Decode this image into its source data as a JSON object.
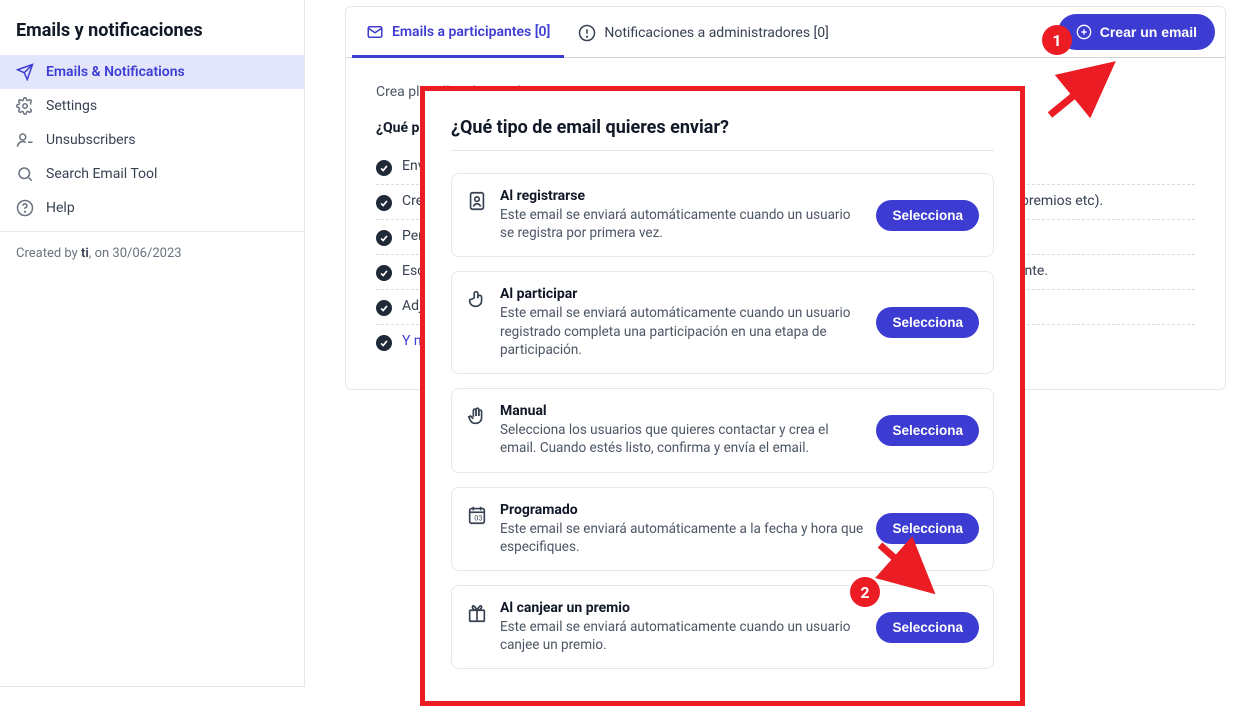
{
  "sidebar": {
    "title": "Emails y notificaciones",
    "items": [
      {
        "label": "Emails & Notifications"
      },
      {
        "label": "Settings"
      },
      {
        "label": "Unsubscribers"
      },
      {
        "label": "Search Email Tool"
      },
      {
        "label": "Help"
      }
    ],
    "footer_prefix": "Created by ",
    "footer_user": "ti",
    "footer_suffix": ", on 30/06/2023"
  },
  "tabs": {
    "participants": "Emails a participantes [0]",
    "admins": "Notificaciones a administradores [0]"
  },
  "create_button": "Crear un email",
  "content": {
    "desc": "Crea plantillas de emails para enviar a tus usuarios.",
    "subheading": "¿Qué puedes hacer?",
    "bullets": [
      "Enviar emails a todos los usuarios de tu promoción o solo a algunos.",
      "Crear emails de bienvenida cuando los usuarios se registren, confirmando su participación (puntos, premios etc).",
      "Personalizar el email con el estilo de tu marca, colores, logo e imágenes de cabecera.",
      "Escribir textos usando información dinámica como los puntos que ha obtenido según cada participante.",
      "Adjuntar archivos, descuentos y links."
    ],
    "more": "Y mucho más..."
  },
  "modal": {
    "title": "¿Qué tipo de email quieres enviar?",
    "options": [
      {
        "title": "Al registrarse",
        "desc": "Este email se enviará automáticamente cuando un usuario se registra por primera vez.",
        "button": "Selecciona"
      },
      {
        "title": "Al participar",
        "desc": "Este email se enviará automáticamente cuando un usuario registrado completa una participación en una etapa de participación.",
        "button": "Selecciona"
      },
      {
        "title": "Manual",
        "desc": "Selecciona los usuarios que quieres contactar y crea el email. Cuando estés listo, confirma y envía el email.",
        "button": "Selecciona"
      },
      {
        "title": "Programado",
        "desc": "Este email se enviará automáticamente a la fecha y hora que especifiques.",
        "button": "Selecciona"
      },
      {
        "title": "Al canjear un premio",
        "desc": "Este email se enviará automaticamente cuando un usuario canjee un premio.",
        "button": "Selecciona"
      }
    ]
  },
  "annotations": {
    "one": "1",
    "two": "2"
  }
}
